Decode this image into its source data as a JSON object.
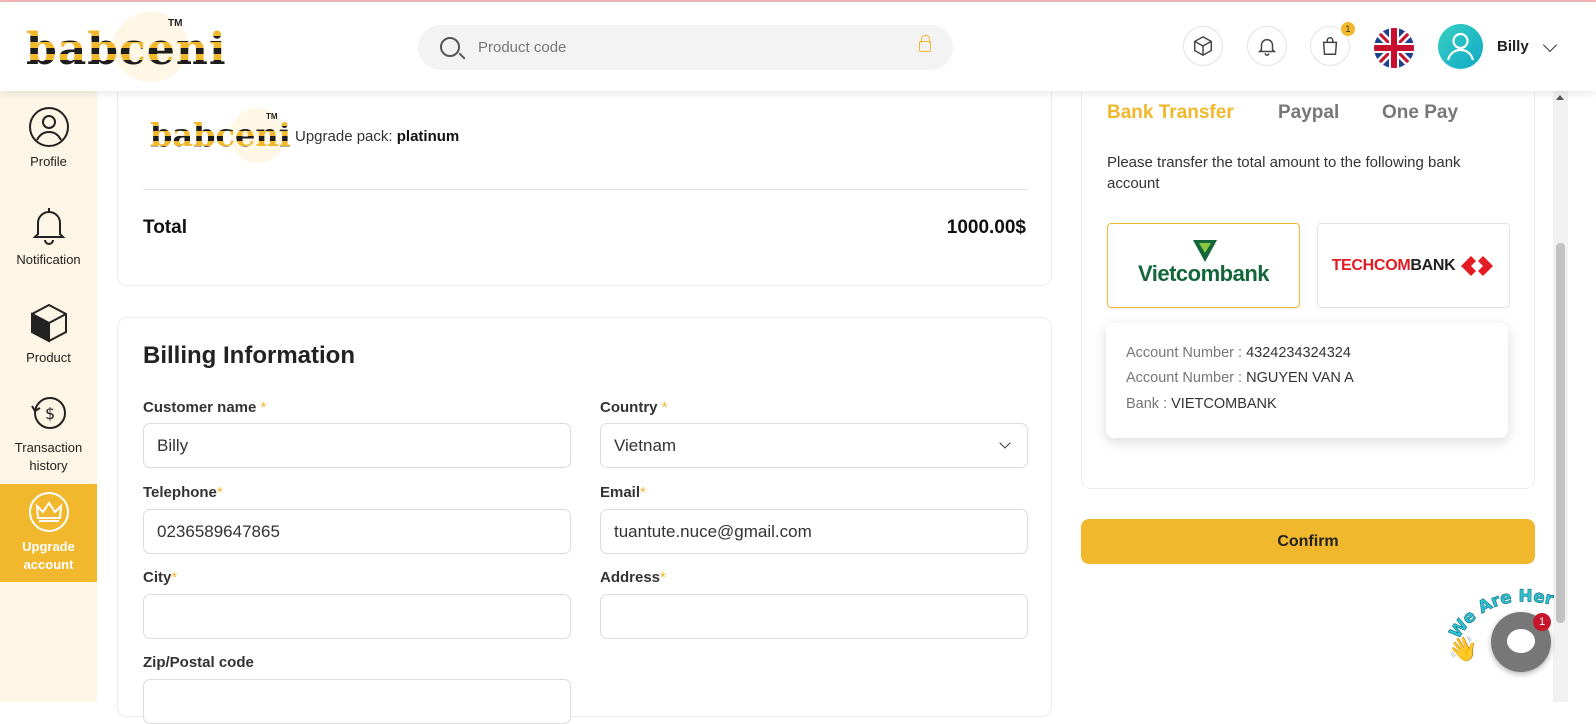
{
  "header": {
    "logo_text": "babceni",
    "logo_tm": "TM",
    "search_placeholder": "Product code",
    "cart_badge": "1",
    "username": "Billy"
  },
  "sidebar": {
    "items": [
      {
        "label": "Profile",
        "icon": "user-circle-icon"
      },
      {
        "label": "Notification",
        "icon": "bell-icon"
      },
      {
        "label": "Product",
        "icon": "box-icon"
      },
      {
        "label": "Transaction history",
        "icon": "transaction-history-icon"
      },
      {
        "label": "Upgrade account",
        "icon": "crown-icon",
        "active": true
      }
    ]
  },
  "order": {
    "upgrade_label": "Upgrade pack:",
    "upgrade_value": "platinum",
    "total_label": "Total",
    "total_value": "1000.00$"
  },
  "billing": {
    "title": "Billing Information",
    "customer_name_label": "Customer name",
    "customer_name_value": "Billy",
    "country_label": "Country",
    "country_value": "Vietnam",
    "telephone_label": "Telephone",
    "telephone_value": "0236589647865",
    "email_label": "Email",
    "email_value": "tuantute.nuce@gmail.com",
    "city_label": "City",
    "city_value": "",
    "address_label": "Address",
    "address_value": "",
    "zip_label": "Zip/Postal code",
    "required_mark": "*"
  },
  "payment": {
    "tabs": [
      "Bank Transfer",
      "Paypal",
      "One Pay"
    ],
    "active_tab": "Bank Transfer",
    "instruction": "Please transfer the total amount to the following bank account",
    "banks": [
      {
        "name": "Vietcombank",
        "selected": true
      },
      {
        "name_red": "TECHCOM",
        "name_dark": "BANK",
        "selected": false
      }
    ],
    "account": {
      "number_label": "Account Number :",
      "number_value": "4324234324324",
      "holder_label": "Account Number :",
      "holder_value": "NGUYEN VAN A",
      "bank_label": "Bank :",
      "bank_value": "VIETCOMBANK"
    },
    "confirm_label": "Confirm"
  },
  "chat": {
    "tagline": "We Are Here!",
    "badge": "1"
  },
  "colors": {
    "accent": "#f1b82d",
    "sidebar_bg": "#fdf5e6",
    "vietcombank_green": "#13663a",
    "techcombank_red": "#e31b23"
  }
}
